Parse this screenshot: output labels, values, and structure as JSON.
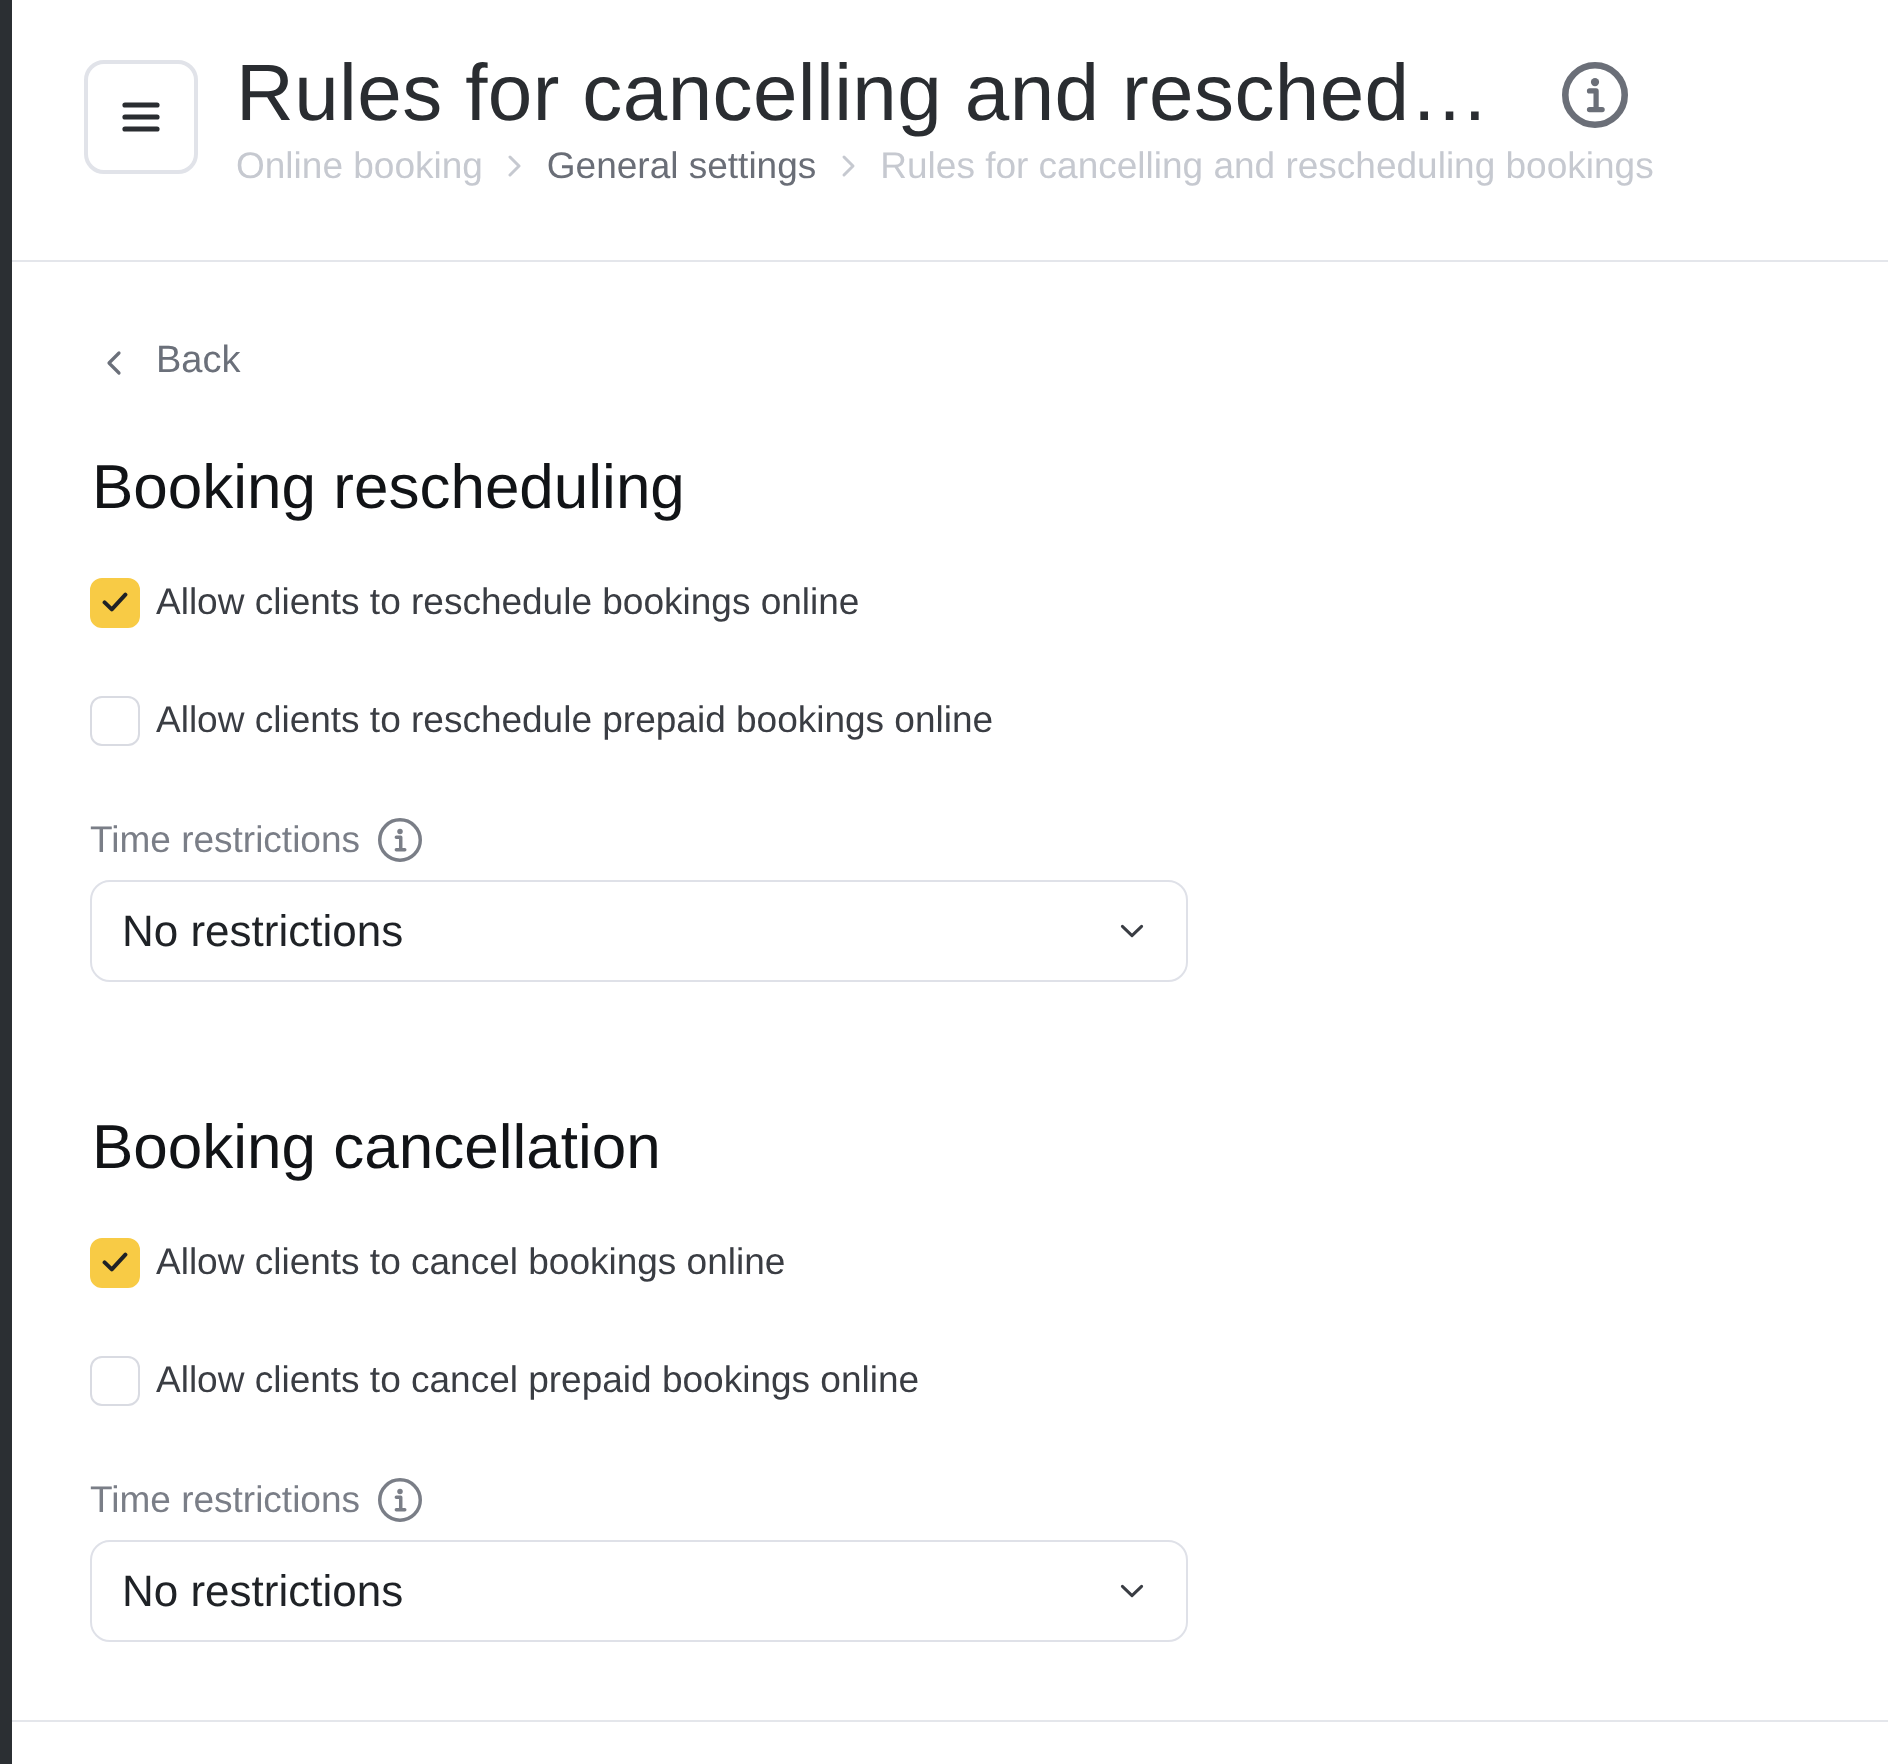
{
  "header": {
    "title": "Rules for cancelling and resched…",
    "breadcrumbs": [
      {
        "label": "Online booking",
        "highlighted": false
      },
      {
        "label": "General settings",
        "highlighted": true
      },
      {
        "label": "Rules for cancelling and rescheduling bookings",
        "highlighted": false
      }
    ]
  },
  "back": {
    "label": "Back"
  },
  "sections": [
    {
      "heading": "Booking rescheduling",
      "options": [
        {
          "label": "Allow clients to reschedule bookings online",
          "checked": true
        },
        {
          "label": "Allow clients to reschedule prepaid bookings online",
          "checked": false
        }
      ],
      "field": {
        "label": "Time restrictions",
        "value": "No restrictions"
      }
    },
    {
      "heading": "Booking cancellation",
      "options": [
        {
          "label": "Allow clients to cancel bookings online",
          "checked": true
        },
        {
          "label": "Allow clients to cancel prepaid bookings online",
          "checked": false
        }
      ],
      "field": {
        "label": "Time restrictions",
        "value": "No restrictions"
      }
    }
  ]
}
